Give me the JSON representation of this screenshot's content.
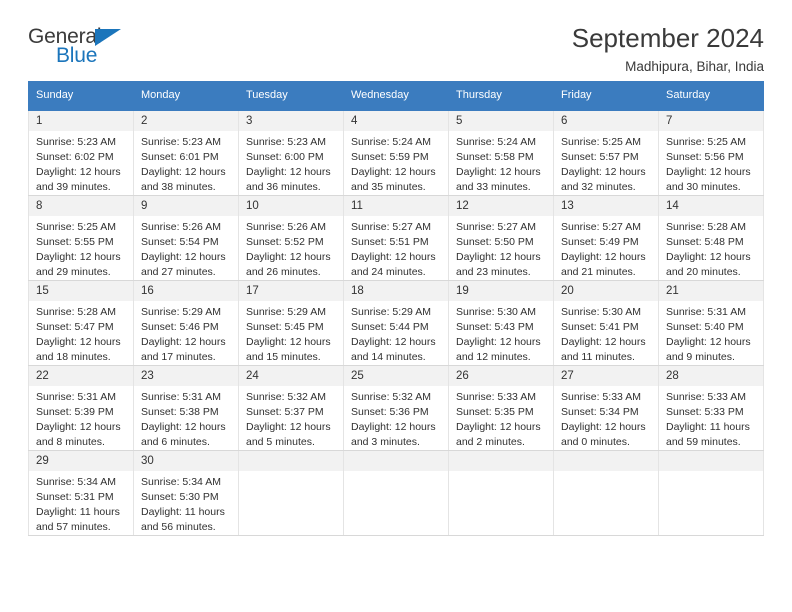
{
  "brand": {
    "name_part1": "General",
    "name_part2": "Blue",
    "triangle_icon": "triangle-icon",
    "accent_color": "#1b75bb"
  },
  "header": {
    "title": "September 2024",
    "subtitle": "Madhipura, Bihar, India"
  },
  "theme": {
    "header_row_bg": "#3b7cbf",
    "daynum_bg": "#f2f2f2",
    "grid_border": "#e4e4e4",
    "text_color": "#303030"
  },
  "weekdays": [
    "Sunday",
    "Monday",
    "Tuesday",
    "Wednesday",
    "Thursday",
    "Friday",
    "Saturday"
  ],
  "labels": {
    "sunrise_prefix": "Sunrise:",
    "sunset_prefix": "Sunset:",
    "daylight_prefix": "Daylight:"
  },
  "weeks": [
    [
      {
        "day": "1",
        "sunrise": "Sunrise: 5:23 AM",
        "sunset": "Sunset: 6:02 PM",
        "daylight_line1": "Daylight: 12 hours",
        "daylight_line2": "and 39 minutes."
      },
      {
        "day": "2",
        "sunrise": "Sunrise: 5:23 AM",
        "sunset": "Sunset: 6:01 PM",
        "daylight_line1": "Daylight: 12 hours",
        "daylight_line2": "and 38 minutes."
      },
      {
        "day": "3",
        "sunrise": "Sunrise: 5:23 AM",
        "sunset": "Sunset: 6:00 PM",
        "daylight_line1": "Daylight: 12 hours",
        "daylight_line2": "and 36 minutes."
      },
      {
        "day": "4",
        "sunrise": "Sunrise: 5:24 AM",
        "sunset": "Sunset: 5:59 PM",
        "daylight_line1": "Daylight: 12 hours",
        "daylight_line2": "and 35 minutes."
      },
      {
        "day": "5",
        "sunrise": "Sunrise: 5:24 AM",
        "sunset": "Sunset: 5:58 PM",
        "daylight_line1": "Daylight: 12 hours",
        "daylight_line2": "and 33 minutes."
      },
      {
        "day": "6",
        "sunrise": "Sunrise: 5:25 AM",
        "sunset": "Sunset: 5:57 PM",
        "daylight_line1": "Daylight: 12 hours",
        "daylight_line2": "and 32 minutes."
      },
      {
        "day": "7",
        "sunrise": "Sunrise: 5:25 AM",
        "sunset": "Sunset: 5:56 PM",
        "daylight_line1": "Daylight: 12 hours",
        "daylight_line2": "and 30 minutes."
      }
    ],
    [
      {
        "day": "8",
        "sunrise": "Sunrise: 5:25 AM",
        "sunset": "Sunset: 5:55 PM",
        "daylight_line1": "Daylight: 12 hours",
        "daylight_line2": "and 29 minutes."
      },
      {
        "day": "9",
        "sunrise": "Sunrise: 5:26 AM",
        "sunset": "Sunset: 5:54 PM",
        "daylight_line1": "Daylight: 12 hours",
        "daylight_line2": "and 27 minutes."
      },
      {
        "day": "10",
        "sunrise": "Sunrise: 5:26 AM",
        "sunset": "Sunset: 5:52 PM",
        "daylight_line1": "Daylight: 12 hours",
        "daylight_line2": "and 26 minutes."
      },
      {
        "day": "11",
        "sunrise": "Sunrise: 5:27 AM",
        "sunset": "Sunset: 5:51 PM",
        "daylight_line1": "Daylight: 12 hours",
        "daylight_line2": "and 24 minutes."
      },
      {
        "day": "12",
        "sunrise": "Sunrise: 5:27 AM",
        "sunset": "Sunset: 5:50 PM",
        "daylight_line1": "Daylight: 12 hours",
        "daylight_line2": "and 23 minutes."
      },
      {
        "day": "13",
        "sunrise": "Sunrise: 5:27 AM",
        "sunset": "Sunset: 5:49 PM",
        "daylight_line1": "Daylight: 12 hours",
        "daylight_line2": "and 21 minutes."
      },
      {
        "day": "14",
        "sunrise": "Sunrise: 5:28 AM",
        "sunset": "Sunset: 5:48 PM",
        "daylight_line1": "Daylight: 12 hours",
        "daylight_line2": "and 20 minutes."
      }
    ],
    [
      {
        "day": "15",
        "sunrise": "Sunrise: 5:28 AM",
        "sunset": "Sunset: 5:47 PM",
        "daylight_line1": "Daylight: 12 hours",
        "daylight_line2": "and 18 minutes."
      },
      {
        "day": "16",
        "sunrise": "Sunrise: 5:29 AM",
        "sunset": "Sunset: 5:46 PM",
        "daylight_line1": "Daylight: 12 hours",
        "daylight_line2": "and 17 minutes."
      },
      {
        "day": "17",
        "sunrise": "Sunrise: 5:29 AM",
        "sunset": "Sunset: 5:45 PM",
        "daylight_line1": "Daylight: 12 hours",
        "daylight_line2": "and 15 minutes."
      },
      {
        "day": "18",
        "sunrise": "Sunrise: 5:29 AM",
        "sunset": "Sunset: 5:44 PM",
        "daylight_line1": "Daylight: 12 hours",
        "daylight_line2": "and 14 minutes."
      },
      {
        "day": "19",
        "sunrise": "Sunrise: 5:30 AM",
        "sunset": "Sunset: 5:43 PM",
        "daylight_line1": "Daylight: 12 hours",
        "daylight_line2": "and 12 minutes."
      },
      {
        "day": "20",
        "sunrise": "Sunrise: 5:30 AM",
        "sunset": "Sunset: 5:41 PM",
        "daylight_line1": "Daylight: 12 hours",
        "daylight_line2": "and 11 minutes."
      },
      {
        "day": "21",
        "sunrise": "Sunrise: 5:31 AM",
        "sunset": "Sunset: 5:40 PM",
        "daylight_line1": "Daylight: 12 hours",
        "daylight_line2": "and 9 minutes."
      }
    ],
    [
      {
        "day": "22",
        "sunrise": "Sunrise: 5:31 AM",
        "sunset": "Sunset: 5:39 PM",
        "daylight_line1": "Daylight: 12 hours",
        "daylight_line2": "and 8 minutes."
      },
      {
        "day": "23",
        "sunrise": "Sunrise: 5:31 AM",
        "sunset": "Sunset: 5:38 PM",
        "daylight_line1": "Daylight: 12 hours",
        "daylight_line2": "and 6 minutes."
      },
      {
        "day": "24",
        "sunrise": "Sunrise: 5:32 AM",
        "sunset": "Sunset: 5:37 PM",
        "daylight_line1": "Daylight: 12 hours",
        "daylight_line2": "and 5 minutes."
      },
      {
        "day": "25",
        "sunrise": "Sunrise: 5:32 AM",
        "sunset": "Sunset: 5:36 PM",
        "daylight_line1": "Daylight: 12 hours",
        "daylight_line2": "and 3 minutes."
      },
      {
        "day": "26",
        "sunrise": "Sunrise: 5:33 AM",
        "sunset": "Sunset: 5:35 PM",
        "daylight_line1": "Daylight: 12 hours",
        "daylight_line2": "and 2 minutes."
      },
      {
        "day": "27",
        "sunrise": "Sunrise: 5:33 AM",
        "sunset": "Sunset: 5:34 PM",
        "daylight_line1": "Daylight: 12 hours",
        "daylight_line2": "and 0 minutes."
      },
      {
        "day": "28",
        "sunrise": "Sunrise: 5:33 AM",
        "sunset": "Sunset: 5:33 PM",
        "daylight_line1": "Daylight: 11 hours",
        "daylight_line2": "and 59 minutes."
      }
    ],
    [
      {
        "day": "29",
        "sunrise": "Sunrise: 5:34 AM",
        "sunset": "Sunset: 5:31 PM",
        "daylight_line1": "Daylight: 11 hours",
        "daylight_line2": "and 57 minutes."
      },
      {
        "day": "30",
        "sunrise": "Sunrise: 5:34 AM",
        "sunset": "Sunset: 5:30 PM",
        "daylight_line1": "Daylight: 11 hours",
        "daylight_line2": "and 56 minutes."
      },
      {
        "day": "",
        "sunrise": "",
        "sunset": "",
        "daylight_line1": "",
        "daylight_line2": ""
      },
      {
        "day": "",
        "sunrise": "",
        "sunset": "",
        "daylight_line1": "",
        "daylight_line2": ""
      },
      {
        "day": "",
        "sunrise": "",
        "sunset": "",
        "daylight_line1": "",
        "daylight_line2": ""
      },
      {
        "day": "",
        "sunrise": "",
        "sunset": "",
        "daylight_line1": "",
        "daylight_line2": ""
      },
      {
        "day": "",
        "sunrise": "",
        "sunset": "",
        "daylight_line1": "",
        "daylight_line2": ""
      }
    ]
  ]
}
